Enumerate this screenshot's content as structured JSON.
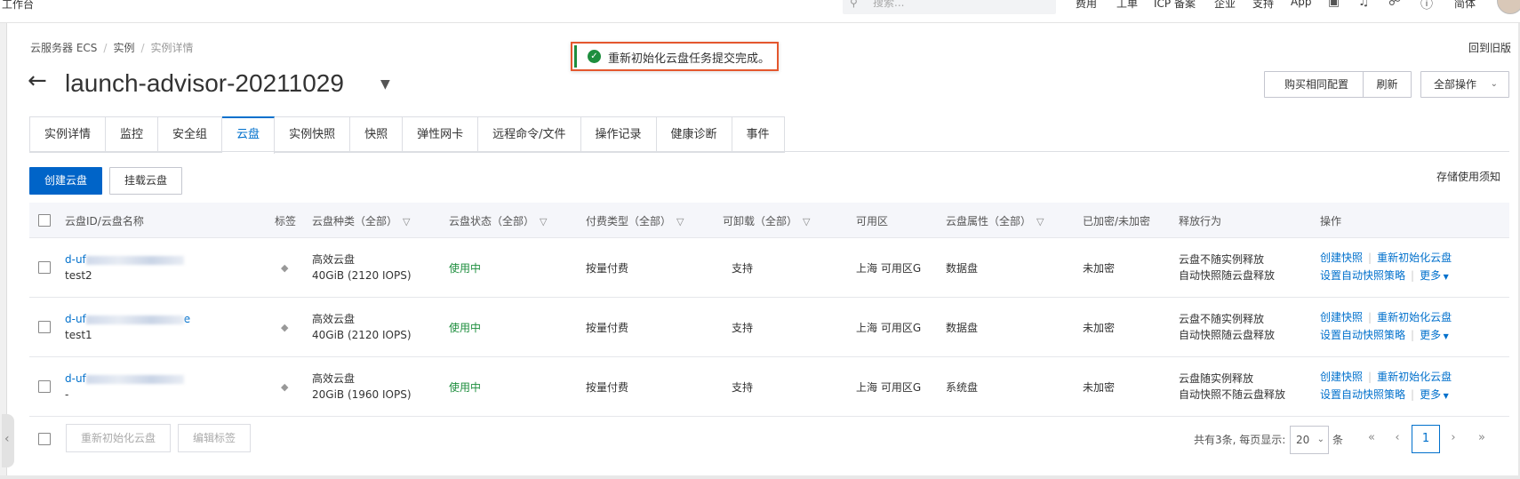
{
  "topbar": {
    "workspace": "工作台",
    "search_placeholder": "搜索...",
    "nav": [
      "费用",
      "工单",
      "ICP 备案",
      "企业",
      "支持",
      "App"
    ],
    "lang": "简体"
  },
  "breadcrumb": [
    "云服务器 ECS",
    "实例",
    "实例详情"
  ],
  "old_version_link": "回到旧版",
  "toast": {
    "message": "重新初始化云盘任务提交完成。",
    "status": "success"
  },
  "header": {
    "title": "launch-advisor-20211029",
    "buttons": [
      "购买相同配置",
      "刷新",
      "全部操作"
    ]
  },
  "tabs": [
    {
      "label": "实例详情",
      "active": false
    },
    {
      "label": "监控",
      "active": false
    },
    {
      "label": "安全组",
      "active": false
    },
    {
      "label": "云盘",
      "active": true
    },
    {
      "label": "实例快照",
      "active": false
    },
    {
      "label": "快照",
      "active": false
    },
    {
      "label": "弹性网卡",
      "active": false
    },
    {
      "label": "远程命令/文件",
      "active": false
    },
    {
      "label": "操作记录",
      "active": false
    },
    {
      "label": "健康诊断",
      "active": false
    },
    {
      "label": "事件",
      "active": false
    }
  ],
  "toolbar": {
    "create_disk": "创建云盘",
    "attach_disk": "挂载云盘",
    "storage_note": "存储使用须知"
  },
  "table": {
    "columns": [
      "云盘ID/云盘名称",
      "标签",
      "云盘种类（全部）",
      "云盘状态（全部）",
      "付费类型（全部）",
      "可卸载（全部）",
      "可用区",
      "云盘属性（全部）",
      "已加密/未加密",
      "释放行为",
      "操作"
    ],
    "rows": [
      {
        "id_prefix": "d-uf",
        "id_suffix": "",
        "name": "test2",
        "category": "高效云盘",
        "spec": "40GiB (2120 IOPS)",
        "status": "使用中",
        "billing": "按量付费",
        "detachable": "支持",
        "zone": "上海 可用区G",
        "attribute": "数据盘",
        "encrypted": "未加密",
        "release1": "云盘不随实例释放",
        "release2": "自动快照随云盘释放",
        "op_snapshot": "创建快照",
        "op_reinit": "重新初始化云盘",
        "op_policy": "设置自动快照策略",
        "op_more": "更多"
      },
      {
        "id_prefix": "d-uf",
        "id_suffix": "e",
        "name": "test1",
        "category": "高效云盘",
        "spec": "40GiB (2120 IOPS)",
        "status": "使用中",
        "billing": "按量付费",
        "detachable": "支持",
        "zone": "上海 可用区G",
        "attribute": "数据盘",
        "encrypted": "未加密",
        "release1": "云盘不随实例释放",
        "release2": "自动快照随云盘释放",
        "op_snapshot": "创建快照",
        "op_reinit": "重新初始化云盘",
        "op_policy": "设置自动快照策略",
        "op_more": "更多"
      },
      {
        "id_prefix": "d-uf",
        "id_suffix": "",
        "name": "-",
        "category": "高效云盘",
        "spec": "20GiB (1960 IOPS)",
        "status": "使用中",
        "billing": "按量付费",
        "detachable": "支持",
        "zone": "上海 可用区G",
        "attribute": "系统盘",
        "encrypted": "未加密",
        "release1": "云盘随实例释放",
        "release2": "自动快照不随云盘释放",
        "op_snapshot": "创建快照",
        "op_reinit": "重新初始化云盘",
        "op_policy": "设置自动快照策略",
        "op_more": "更多"
      }
    ]
  },
  "footer": {
    "reinit_button": "重新初始化云盘",
    "edit_tags_button": "编辑标签",
    "total_text": "共有3条, 每页显示:",
    "page_size": "20",
    "unit": "条",
    "current_page": "1"
  },
  "colors": {
    "primary": "#0064c8",
    "link": "#0070cc",
    "success": "#1e8e3e",
    "toast_border": "#e4572e"
  }
}
